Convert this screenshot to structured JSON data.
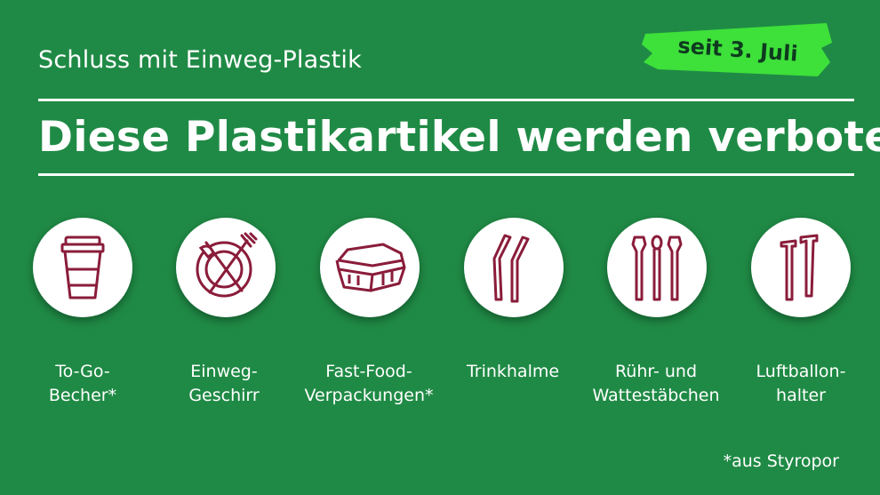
{
  "header": {
    "subtitle": "Schluss mit Einweg-Plastik",
    "badge": "seit 3. Juli",
    "title": "Diese Plastikartikel werden verboten"
  },
  "items": [
    {
      "label_line1": "To-Go-",
      "label_line2": "Becher*",
      "icon": "to-go-cup-icon"
    },
    {
      "label_line1": "Einweg-",
      "label_line2": "Geschirr",
      "icon": "plate-cutlery-icon"
    },
    {
      "label_line1": "Fast-Food-",
      "label_line2": "Verpackungen*",
      "icon": "food-box-icon"
    },
    {
      "label_line1": "Trinkhalme",
      "label_line2": "",
      "icon": "straws-icon"
    },
    {
      "label_line1": "Rühr- und",
      "label_line2": "Wattestäbchen",
      "icon": "stirrers-cotton-buds-icon"
    },
    {
      "label_line1": "Luftballon-",
      "label_line2": "halter",
      "icon": "balloon-sticks-icon"
    }
  ],
  "footnote": "*aus Styropor",
  "colors": {
    "background": "#1f8a45",
    "badge": "#3ee03a",
    "icon": "#8a1c3a",
    "text": "#ffffff"
  }
}
